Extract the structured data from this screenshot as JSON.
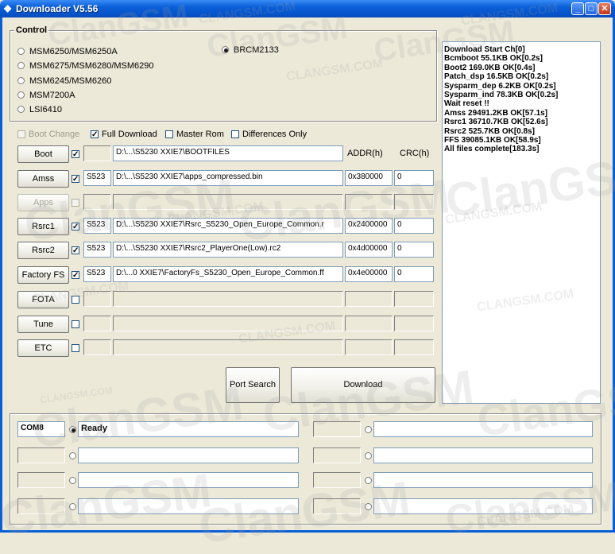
{
  "window": {
    "title": "Downloader V5.56"
  },
  "control": {
    "group_label": "Control",
    "chipsets": [
      {
        "label": "MSM6250/MSM6250A",
        "checked": false
      },
      {
        "label": "MSM6275/MSM6280/MSM6290",
        "checked": false
      },
      {
        "label": "MSM6245/MSM6260",
        "checked": false
      },
      {
        "label": "MSM7200A",
        "checked": false
      },
      {
        "label": "LSI6410",
        "checked": false
      },
      {
        "label": "BRCM2133",
        "checked": true
      }
    ]
  },
  "options": {
    "boot_change": "Boot Change",
    "full_download": "Full Download",
    "master_rom": "Master Rom",
    "differences_only": "Differences Only"
  },
  "table": {
    "addr_header": "ADDR(h)",
    "crc_header": "CRC(h)",
    "rows": [
      {
        "button": "Boot",
        "checked": true,
        "enabled": true,
        "model": "",
        "path": "D:\\...\\S5230 XXIE7\\BOOTFILES",
        "addr": "",
        "crc": ""
      },
      {
        "button": "Amss",
        "checked": true,
        "enabled": true,
        "model": "S523",
        "path": "D:\\...\\S5230 XXIE7\\apps_compressed.bin",
        "addr": "0x380000",
        "crc": "0"
      },
      {
        "button": "Apps",
        "checked": false,
        "enabled": false,
        "model": "",
        "path": "",
        "addr": "",
        "crc": ""
      },
      {
        "button": "Rsrc1",
        "checked": true,
        "enabled": true,
        "model": "S523",
        "path": "D:\\...\\S5230 XXIE7\\Rsrc_S5230_Open_Europe_Common.r",
        "addr": "0x2400000",
        "crc": "0"
      },
      {
        "button": "Rsrc2",
        "checked": true,
        "enabled": true,
        "model": "S523",
        "path": "D:\\...\\S5230 XXIE7\\Rsrc2_PlayerOne(Low).rc2",
        "addr": "0x4d00000",
        "crc": "0"
      },
      {
        "button": "Factory FS",
        "checked": true,
        "enabled": true,
        "model": "S523",
        "path": "D:\\...0 XXIE7\\FactoryFs_S5230_Open_Europe_Common.ff",
        "addr": "0x4e00000",
        "crc": "0"
      },
      {
        "button": "FOTA",
        "checked": false,
        "enabled": true,
        "model": "",
        "path": "",
        "addr": "",
        "crc": ""
      },
      {
        "button": "Tune",
        "checked": false,
        "enabled": true,
        "model": "",
        "path": "",
        "addr": "",
        "crc": ""
      },
      {
        "button": "ETC",
        "checked": false,
        "enabled": true,
        "model": "",
        "path": "",
        "addr": "",
        "crc": ""
      }
    ]
  },
  "actions": {
    "port_search": "Port Search",
    "download": "Download"
  },
  "log": [
    "Download Start Ch[0]",
    "Bcmboot 55.1KB OK[0.2s]",
    "Boot2 169.0KB OK[0.4s]",
    "Patch_dsp 16.5KB OK[0.2s]",
    "Sysparm_dep 6.2KB OK[0.2s]",
    "Sysparm_ind 78.3KB OK[0.2s]",
    "Wait reset !!",
    "Amss 29491.2KB OK[57.1s]",
    "Rsrc1 36710.7KB OK[52.6s]",
    "Rsrc2 525.7KB OK[0.8s]",
    "FFS 39085.1KB OK[58.9s]",
    "All files complete[183.3s]"
  ],
  "ports": [
    {
      "port": "COM8",
      "status": "Ready",
      "selected": true
    },
    {
      "port": "",
      "status": "",
      "selected": false
    },
    {
      "port": "",
      "status": "",
      "selected": false
    },
    {
      "port": "",
      "status": "",
      "selected": false
    },
    {
      "port": "",
      "status": "",
      "selected": false
    },
    {
      "port": "",
      "status": "",
      "selected": false
    },
    {
      "port": "",
      "status": "",
      "selected": false
    },
    {
      "port": "",
      "status": "",
      "selected": false
    }
  ],
  "watermark": {
    "brand": "ClanGSM",
    "site": "CLANGSM.COM"
  }
}
